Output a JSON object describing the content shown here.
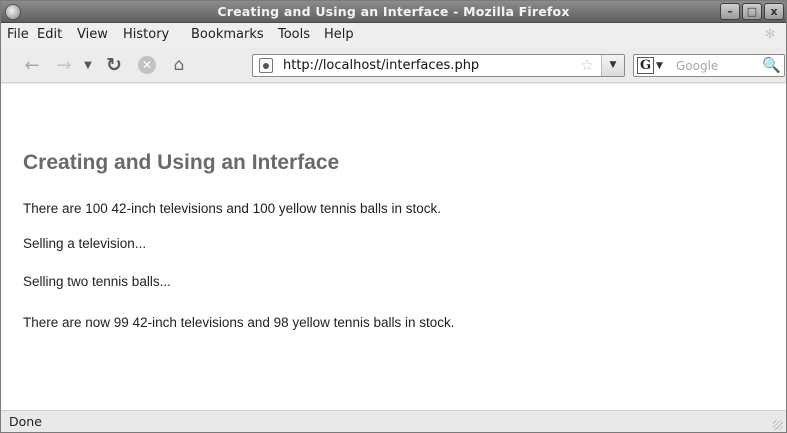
{
  "window": {
    "title": "Creating and Using an Interface - Mozilla Firefox",
    "controls": {
      "minimize": "–",
      "maximize": "□",
      "close": "x"
    }
  },
  "menubar": {
    "items": [
      "File",
      "Edit",
      "View",
      "History",
      "Bookmarks",
      "Tools",
      "Help"
    ]
  },
  "toolbar": {
    "back_icon": "←",
    "forward_icon": "→",
    "history_dropdown_icon": "▼",
    "reload_icon": "↻",
    "stop_icon": "✕",
    "home_icon": "⌂",
    "url": "http://localhost/interfaces.php",
    "bookmark_star_icon": "☆",
    "url_dropdown_icon": "▼",
    "search_engine_letter": "G",
    "search_engine_caret": "▼",
    "search_placeholder": "Google",
    "search_icon": "🔍"
  },
  "page": {
    "heading": "Creating and Using an Interface",
    "paragraphs": [
      "There are 100 42-inch televisions and 100 yellow tennis balls in stock.",
      "Selling a television...",
      "Selling two tennis balls...",
      "There are now 99 42-inch televisions and 98 yellow tennis balls in stock."
    ]
  },
  "status": {
    "text": "Done"
  }
}
